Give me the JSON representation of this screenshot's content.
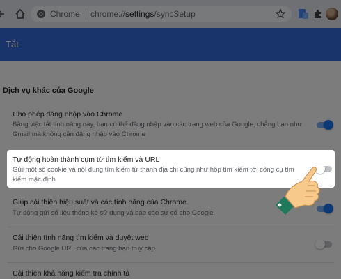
{
  "browser": {
    "site_label": "Chrome",
    "url_prefix": "chrome://",
    "url_path": "settings",
    "url_suffix": "/syncSetup"
  },
  "header": {
    "title": "Tắt"
  },
  "section": {
    "title": "Dịch vụ khác của Google"
  },
  "rows": [
    {
      "title": "Cho phép đăng nhập vào Chrome",
      "desc": "Bằng việc tắt tính năng này, bạn có thể đăng nhập vào các trang web của Google, chẳng hạn như Gmail mà không cần đăng nhập vào Chrome",
      "enabled": true
    },
    {
      "title": "Tự động hoàn thành cụm từ tìm kiếm và URL",
      "desc": "Gửi một số cookie và nội dung tìm kiếm từ thanh địa chỉ cũng như hộp tìm kiếm tới công cụ tìm kiếm mặc định",
      "enabled": false
    },
    {
      "title": "Giúp cải thiện hiệu suất và các tính năng của Chrome",
      "desc": "Tự động gửi số liệu thống kê sử dụng và báo cáo sự cố cho Google",
      "enabled": true
    },
    {
      "title": "Cải thiện tính năng tìm kiếm và duyệt web",
      "desc": "Gửi cho Google URL của các trang bạn truy cập",
      "enabled": false
    },
    {
      "title": "Cải thiện khả năng kiểm tra chính tả",
      "desc": "",
      "enabled": false
    }
  ],
  "colors": {
    "header": "#3367d6",
    "toggle_on": "#1a73e8",
    "hand_skin": "#f7c98b",
    "hand_cuff": "#1e7a5a"
  },
  "icons": [
    "back-icon",
    "home-icon",
    "chrome-logo-icon",
    "star-icon",
    "extension-icon",
    "puzzle-icon",
    "avatar",
    "pointing-hand-icon"
  ]
}
